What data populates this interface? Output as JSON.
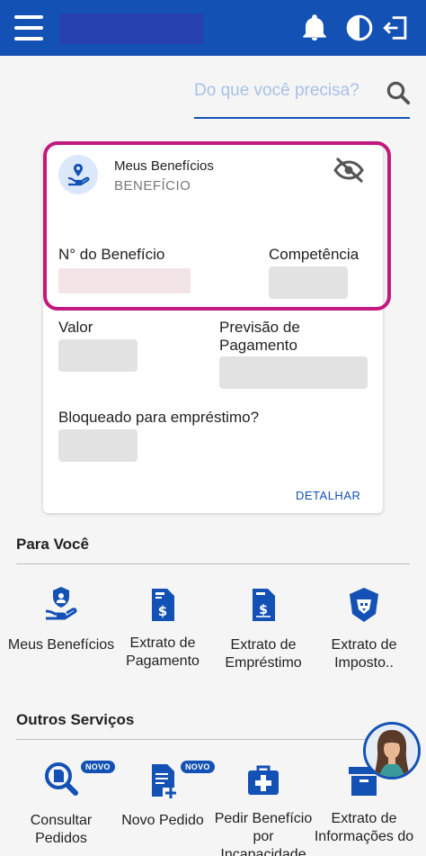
{
  "search": {
    "placeholder": "Do que você precisa?"
  },
  "benefit_card": {
    "title": "Meus Benefícios",
    "subtitle": "BENEFÍCIO",
    "numero_label": "N° do Benefício",
    "competencia_label": "Competência",
    "valor_label": "Valor",
    "previsao_label": "Previsão de Pagamento",
    "bloqueado_label": "Bloqueado para empréstimo?",
    "detail_link": "DETALHAR"
  },
  "para_voce": {
    "title": "Para Você",
    "items": [
      {
        "label": "Meus Benefícios",
        "icon": "hand-shield-icon"
      },
      {
        "label": "Extrato de Pagamento",
        "icon": "document-dollar-icon"
      },
      {
        "label": "Extrato de Empréstimo",
        "icon": "document-dollar-icon"
      },
      {
        "label": "Extrato de Imposto..",
        "icon": "lion-badge-icon"
      }
    ]
  },
  "outros_servicos": {
    "title": "Outros Serviços",
    "items": [
      {
        "label": "Consultar Pedidos",
        "icon": "search-document-icon",
        "badge": "NOVO"
      },
      {
        "label": "Novo Pedido",
        "icon": "new-document-icon",
        "badge": "NOVO"
      },
      {
        "label": "Pedir Benefício por Incapacidade",
        "icon": "medical-kit-icon"
      },
      {
        "label": "Extrato de Informações do",
        "icon": "archive-box-icon"
      }
    ]
  },
  "colors": {
    "primary": "#1351b4",
    "highlight": "#c2187f"
  }
}
